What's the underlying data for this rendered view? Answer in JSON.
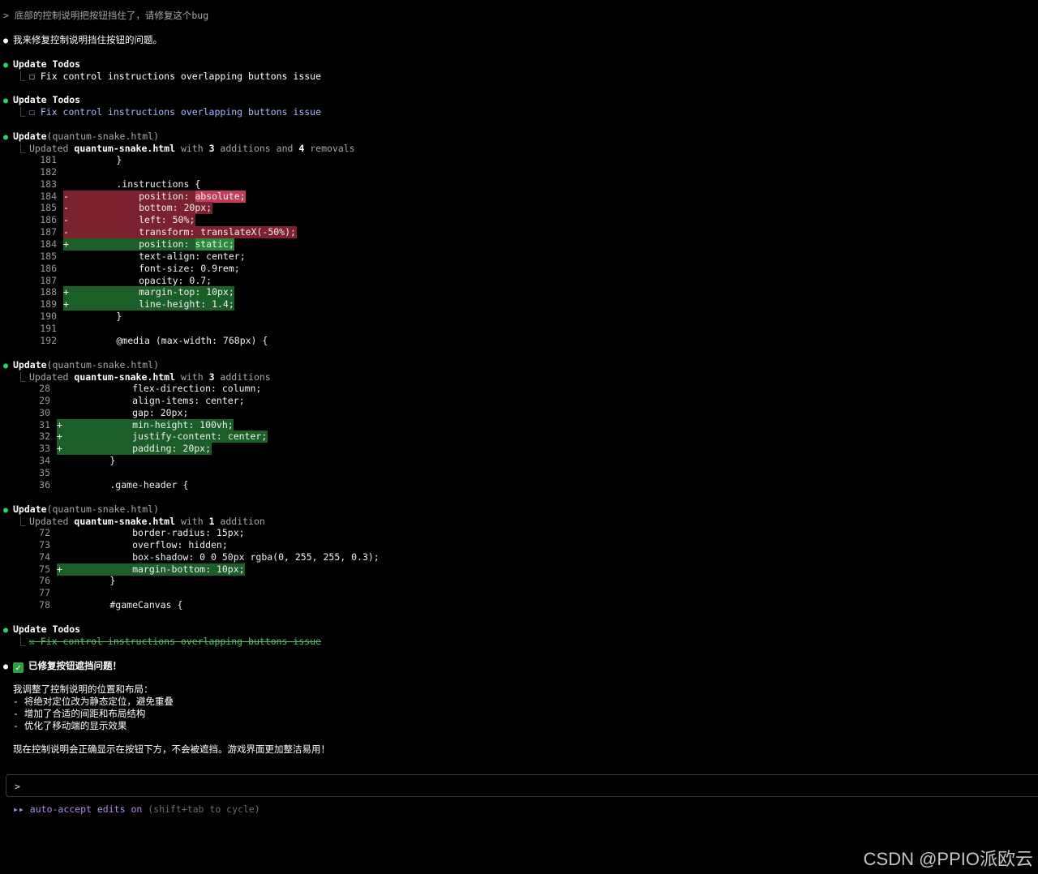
{
  "user_prompt": "> 底部的控制说明把按钮挡住了，请修复这个bug",
  "assistant_intro": "我来修复控制说明挡住按钮的问题。",
  "todo_blocks": [
    {
      "title": "Update Todos",
      "item": "☐ Fix control instructions overlapping buttons issue",
      "state": "pending"
    },
    {
      "title": "Update Todos",
      "item": "☐ Fix control instructions overlapping buttons issue",
      "state": "in_progress"
    },
    {
      "title": "Update Todos",
      "item": "☒ Fix control instructions overlapping buttons issue",
      "state": "done"
    }
  ],
  "updates": [
    {
      "action": "Update",
      "file_arg": "(quantum-snake.html)",
      "summary_prefix": "Updated ",
      "file": "quantum-snake.html",
      "summary_mid": " with ",
      "additions": "3",
      "additions_word": " additions",
      "and": " and ",
      "removals": "4",
      "removals_word": " removals",
      "lines": [
        {
          "n": "181",
          "sign": "",
          "text": "        }",
          "kind": "ctx"
        },
        {
          "n": "182",
          "sign": "",
          "text": "",
          "kind": "ctx"
        },
        {
          "n": "183",
          "sign": "",
          "text": "        .instructions {",
          "kind": "ctx"
        },
        {
          "n": "184",
          "sign": "-",
          "text": "            position: ",
          "strong": "absolute;",
          "kind": "del"
        },
        {
          "n": "185",
          "sign": "-",
          "text": "            bottom: 20px;",
          "kind": "del"
        },
        {
          "n": "186",
          "sign": "-",
          "text": "            left: 50%;",
          "kind": "del"
        },
        {
          "n": "187",
          "sign": "-",
          "text": "            transform: translateX(-50%);",
          "kind": "del"
        },
        {
          "n": "184",
          "sign": "+",
          "text": "            position: ",
          "strong": "static;",
          "kind": "add"
        },
        {
          "n": "185",
          "sign": "",
          "text": "            text-align: center;",
          "kind": "ctx"
        },
        {
          "n": "186",
          "sign": "",
          "text": "            font-size: 0.9rem;",
          "kind": "ctx"
        },
        {
          "n": "187",
          "sign": "",
          "text": "            opacity: 0.7;",
          "kind": "ctx"
        },
        {
          "n": "188",
          "sign": "+",
          "text": "            margin-top: 10px;",
          "kind": "add"
        },
        {
          "n": "189",
          "sign": "+",
          "text": "            line-height: 1.4;",
          "kind": "add"
        },
        {
          "n": "190",
          "sign": "",
          "text": "        }",
          "kind": "ctx"
        },
        {
          "n": "191",
          "sign": "",
          "text": "",
          "kind": "ctx"
        },
        {
          "n": "192",
          "sign": "",
          "text": "        @media (max-width: 768px) {",
          "kind": "ctx"
        }
      ]
    },
    {
      "action": "Update",
      "file_arg": "(quantum-snake.html)",
      "summary_prefix": "Updated ",
      "file": "quantum-snake.html",
      "summary_mid": " with ",
      "additions": "3",
      "additions_word": " additions",
      "lines": [
        {
          "n": "28",
          "sign": "",
          "text": "            flex-direction: column;",
          "kind": "ctx"
        },
        {
          "n": "29",
          "sign": "",
          "text": "            align-items: center;",
          "kind": "ctx"
        },
        {
          "n": "30",
          "sign": "",
          "text": "            gap: 20px;",
          "kind": "ctx"
        },
        {
          "n": "31",
          "sign": "+",
          "text": "            min-height: 100vh;",
          "kind": "add"
        },
        {
          "n": "32",
          "sign": "+",
          "text": "            justify-content: center;",
          "kind": "add"
        },
        {
          "n": "33",
          "sign": "+",
          "text": "            padding: 20px;",
          "kind": "add"
        },
        {
          "n": "34",
          "sign": "",
          "text": "        }",
          "kind": "ctx"
        },
        {
          "n": "35",
          "sign": "",
          "text": "",
          "kind": "ctx"
        },
        {
          "n": "36",
          "sign": "",
          "text": "        .game-header {",
          "kind": "ctx"
        }
      ]
    },
    {
      "action": "Update",
      "file_arg": "(quantum-snake.html)",
      "summary_prefix": "Updated ",
      "file": "quantum-snake.html",
      "summary_mid": " with ",
      "additions": "1",
      "additions_word": " addition",
      "lines": [
        {
          "n": "72",
          "sign": "",
          "text": "            border-radius: 15px;",
          "kind": "ctx"
        },
        {
          "n": "73",
          "sign": "",
          "text": "            overflow: hidden;",
          "kind": "ctx"
        },
        {
          "n": "74",
          "sign": "",
          "text": "            box-shadow: 0 0 50px rgba(0, 255, 255, 0.3);",
          "kind": "ctx"
        },
        {
          "n": "75",
          "sign": "+",
          "text": "            margin-bottom: 10px;",
          "kind": "add"
        },
        {
          "n": "76",
          "sign": "",
          "text": "        }",
          "kind": "ctx"
        },
        {
          "n": "77",
          "sign": "",
          "text": "",
          "kind": "ctx"
        },
        {
          "n": "78",
          "sign": "",
          "text": "        #gameCanvas {",
          "kind": "ctx"
        }
      ]
    }
  ],
  "done_title": "已修复按钮遮挡问题！",
  "done_check_icon": "check-mark-icon",
  "summary_lines": [
    "我调整了控制说明的位置和布局：",
    "- 将绝对定位改为静态定位，避免重叠",
    "- 增加了合适的间距和布局结构",
    "- 优化了移动端的显示效果"
  ],
  "final_line": "现在控制说明会正确显示在按钮下方，不会被遮挡。游戏界面更加整洁易用！",
  "input": {
    "caret": ">",
    "value": ""
  },
  "mode": {
    "arrows": "▸▸",
    "label": "auto-accept edits",
    "state": "on",
    "hint": "(shift+tab to cycle)"
  },
  "watermark": "CSDN @PPIO派欧云",
  "colors": {
    "added": "#1c5e27",
    "removed": "#7c2130",
    "bullet": "#2fd06a",
    "accent": "#b18cf0"
  }
}
